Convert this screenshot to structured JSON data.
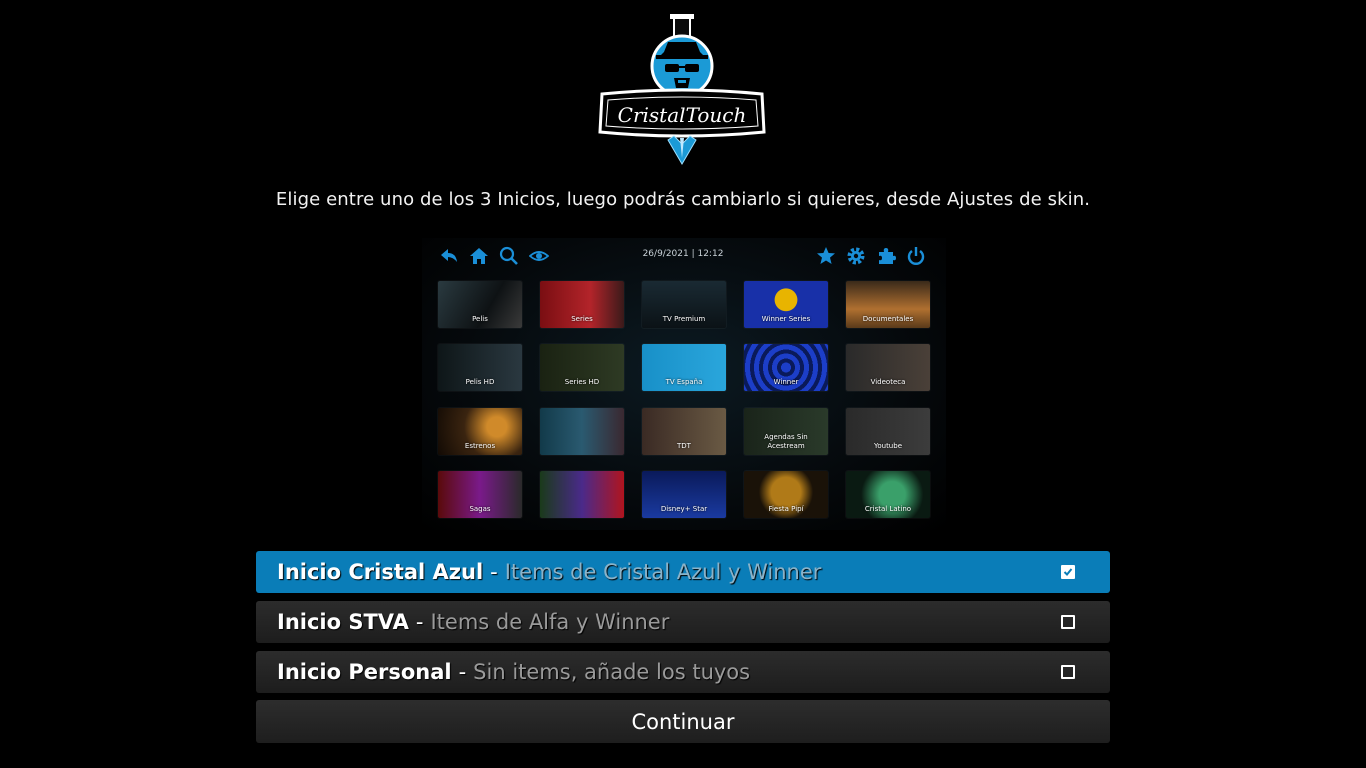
{
  "logo": {
    "text": "CristalTouch"
  },
  "instructions": "Elige entre uno de los 3 Inicios, luego podrás cambiarlo si quieres, desde Ajustes de skin.",
  "preview": {
    "datetime": "26/9/2021  |  12:12",
    "left_icons": [
      "back-icon",
      "home-icon",
      "search-icon",
      "eye-icon"
    ],
    "right_icons": [
      "star-icon",
      "gear-icon",
      "puzzle-icon",
      "power-icon"
    ],
    "accent": "#1a8fd8",
    "tiles": [
      [
        "Pelis",
        "Series",
        "TV Premium",
        "Winner Series",
        "Documentales"
      ],
      [
        "Pelis HD",
        "Series HD",
        "TV España",
        "Winner",
        "Videoteca"
      ],
      [
        "Estrenos",
        "",
        "TDT",
        "Agendas Sin Acestream",
        "Youtube"
      ],
      [
        "Sagas",
        "",
        "Disney+ Star",
        "Fiesta Pipí",
        "Cristal Latino"
      ]
    ]
  },
  "options": [
    {
      "title": "Inicio Cristal Azul",
      "separator": "-",
      "subtitle": "Items de Cristal Azul y Winner",
      "checked": true
    },
    {
      "title": "Inicio STVA",
      "separator": "-",
      "subtitle": "Items de Alfa y Winner",
      "checked": false
    },
    {
      "title": "Inicio Personal",
      "separator": "-",
      "subtitle": "Sin items, añade los tuyos",
      "checked": false
    }
  ],
  "continue_label": "Continuar",
  "colors": {
    "selected": "#0a7db8",
    "background": "#000000",
    "button": "#262626"
  }
}
